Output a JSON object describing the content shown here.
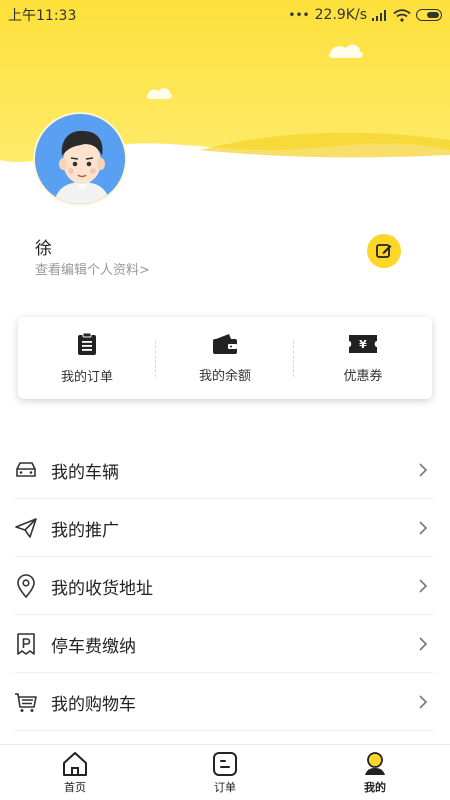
{
  "status_bar": {
    "time": "上午11:33",
    "speed": "22.9K/s",
    "dots": "•••"
  },
  "profile": {
    "name": "徐",
    "subtitle": "查看编辑个人资料>"
  },
  "quick_actions": [
    {
      "label": "我的订单",
      "icon": "clipboard-icon"
    },
    {
      "label": "我的余额",
      "icon": "wallet-icon"
    },
    {
      "label": "优惠券",
      "icon": "coupon-icon"
    }
  ],
  "menu": [
    {
      "label": "我的车辆",
      "icon": "car-icon"
    },
    {
      "label": "我的推广",
      "icon": "paper-plane-icon"
    },
    {
      "label": "我的收货地址",
      "icon": "location-pin-icon"
    },
    {
      "label": "停车费缴纳",
      "icon": "parking-icon"
    },
    {
      "label": "我的购物车",
      "icon": "shopping-cart-icon"
    }
  ],
  "tabs": [
    {
      "label": "首页",
      "icon": "home-icon",
      "active": false
    },
    {
      "label": "订单",
      "icon": "order-icon",
      "active": false
    },
    {
      "label": "我的",
      "icon": "profile-icon",
      "active": true
    }
  ],
  "colors": {
    "accent": "#fcd728",
    "header_yellow": "#fde44a",
    "avatar_bg": "#5aa0f2"
  }
}
